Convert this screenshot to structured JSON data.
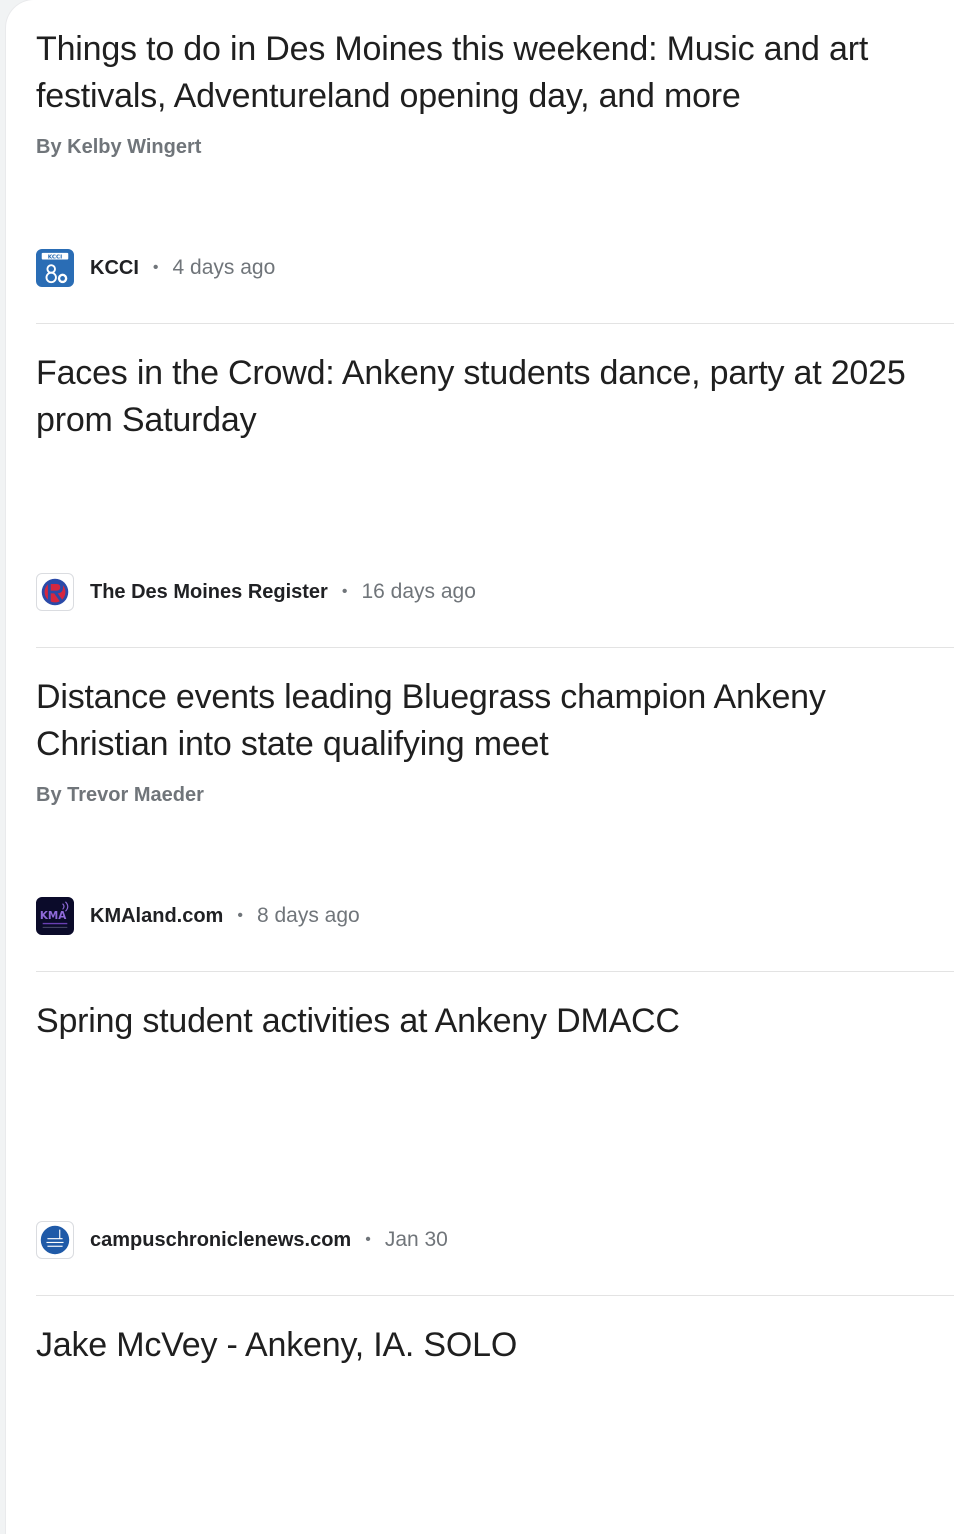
{
  "articles": [
    {
      "headline": "Things to do in Des Moines this weekend: Music and art festivals, Adventureland opening day, and more",
      "byline": "By Kelby Wingert",
      "source": "KCCI",
      "favicon_text": "KCCI",
      "favicon_icon": "kcci-8-logo",
      "age": "4 days ago"
    },
    {
      "headline": "Faces in the Crowd: Ankeny students dance, party at 2025 prom Saturday",
      "byline": "",
      "source": "The Des Moines Register",
      "favicon_icon": "des-moines-register-logo",
      "age": "16 days ago"
    },
    {
      "headline": "Distance events leading Bluegrass champion Ankeny Christian into state qualifying meet",
      "byline": "By Trevor Maeder",
      "source": "KMAland.com",
      "favicon_text": "KMA",
      "favicon_icon": "kmaland-logo",
      "age": "8 days ago"
    },
    {
      "headline": "Spring student activities at Ankeny DMACC",
      "byline": "",
      "source": "campuschroniclenews.com",
      "favicon_icon": "campus-chronicle-logo",
      "age": "Jan 30"
    },
    {
      "headline": "Jake McVey - Ankeny, IA. SOLO"
    }
  ],
  "separator": "•",
  "colors": {
    "headline": "#1f1f1f",
    "meta": "#70757a",
    "source": "#202124",
    "divider": "#e3e3e3",
    "kcci_blue": "#2a6db5",
    "register_red": "#d6273f",
    "register_blue": "#2b4aa8",
    "kma_purple": "#6a3fb3",
    "campus_blue": "#1f5aa8"
  }
}
